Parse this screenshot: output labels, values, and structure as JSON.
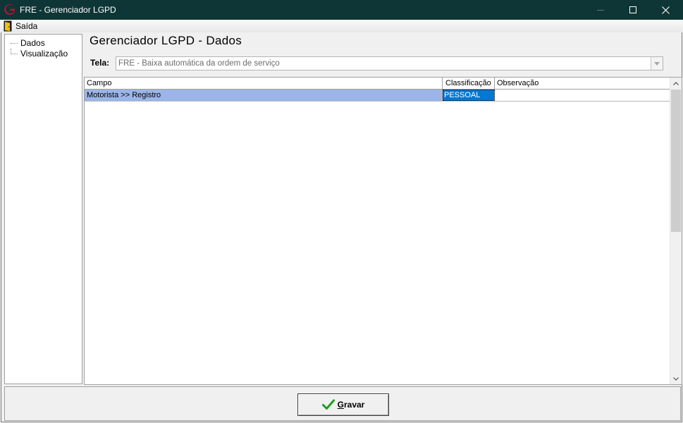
{
  "window": {
    "title": "FRE - Gerenciador LGPD",
    "colors": {
      "titlebar": "#0f3636",
      "logo": "#c8102e",
      "row_highlight": "#9bb5e8",
      "cell_selected": "#0078d7",
      "checkmark": "#1e9e1e"
    }
  },
  "menu": {
    "items": [
      {
        "label": "Saída",
        "icon": "exit-door-icon"
      }
    ]
  },
  "tree": {
    "items": [
      {
        "label": "Dados"
      },
      {
        "label": "Visualização"
      }
    ]
  },
  "content": {
    "title": "Gerenciador LGPD - Dados",
    "tela_label": "Tela:",
    "tela_value": "FRE - Baixa automática da ordem de serviço"
  },
  "grid": {
    "columns": [
      "Campo",
      "Classificação",
      "Observação"
    ],
    "rows": [
      {
        "campo": "Motorista >> Registro",
        "classificacao": "PESSOAL",
        "observacao": ""
      }
    ]
  },
  "footer": {
    "gravar_label": "Gravar"
  }
}
